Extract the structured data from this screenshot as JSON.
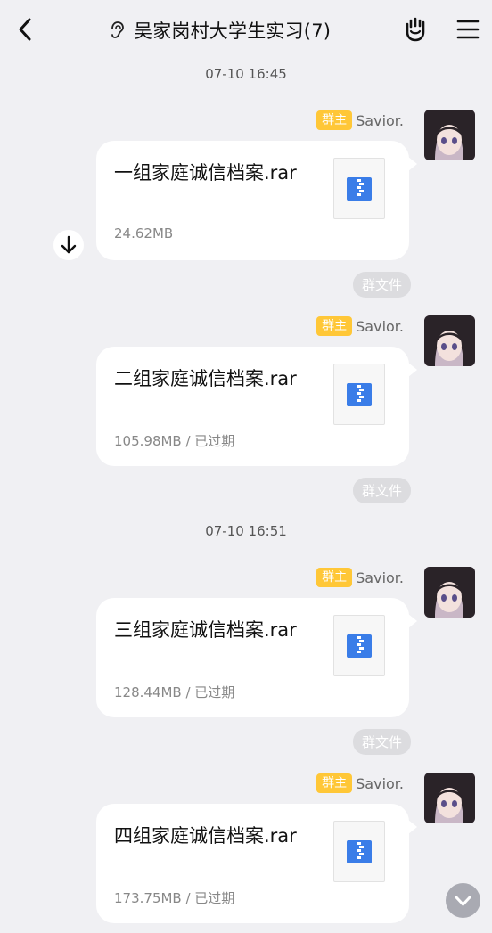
{
  "header": {
    "title": "吴家岗村大学生实习(7)"
  },
  "timestamps": [
    "07-10 16:45",
    "07-10 16:51"
  ],
  "messages": [
    {
      "role_badge": "群主",
      "sender": "Savior.",
      "file_name": "一组家庭诚信档案.rar",
      "meta": "24.62MB",
      "tag": "群文件"
    },
    {
      "role_badge": "群主",
      "sender": "Savior.",
      "file_name": "二组家庭诚信档案.rar",
      "meta": "105.98MB / 已过期",
      "tag": "群文件"
    },
    {
      "role_badge": "群主",
      "sender": "Savior.",
      "file_name": "三组家庭诚信档案.rar",
      "meta": "128.44MB / 已过期",
      "tag": "群文件"
    },
    {
      "role_badge": "群主",
      "sender": "Savior.",
      "file_name": "四组家庭诚信档案.rar",
      "meta": "173.75MB / 已过期"
    }
  ],
  "icons": {
    "back": "back-arrow-icon",
    "ear": "ear-icon",
    "hand": "hand-icon",
    "menu": "menu-icon",
    "file": "rar-archive-icon",
    "download": "download-arrow-icon",
    "scroll_down": "chevron-down-icon"
  },
  "colors": {
    "background": "#f0f0f3",
    "badge": "#ffc737",
    "file_icon": "#3a7de8",
    "tag": "#dcdcdf"
  }
}
